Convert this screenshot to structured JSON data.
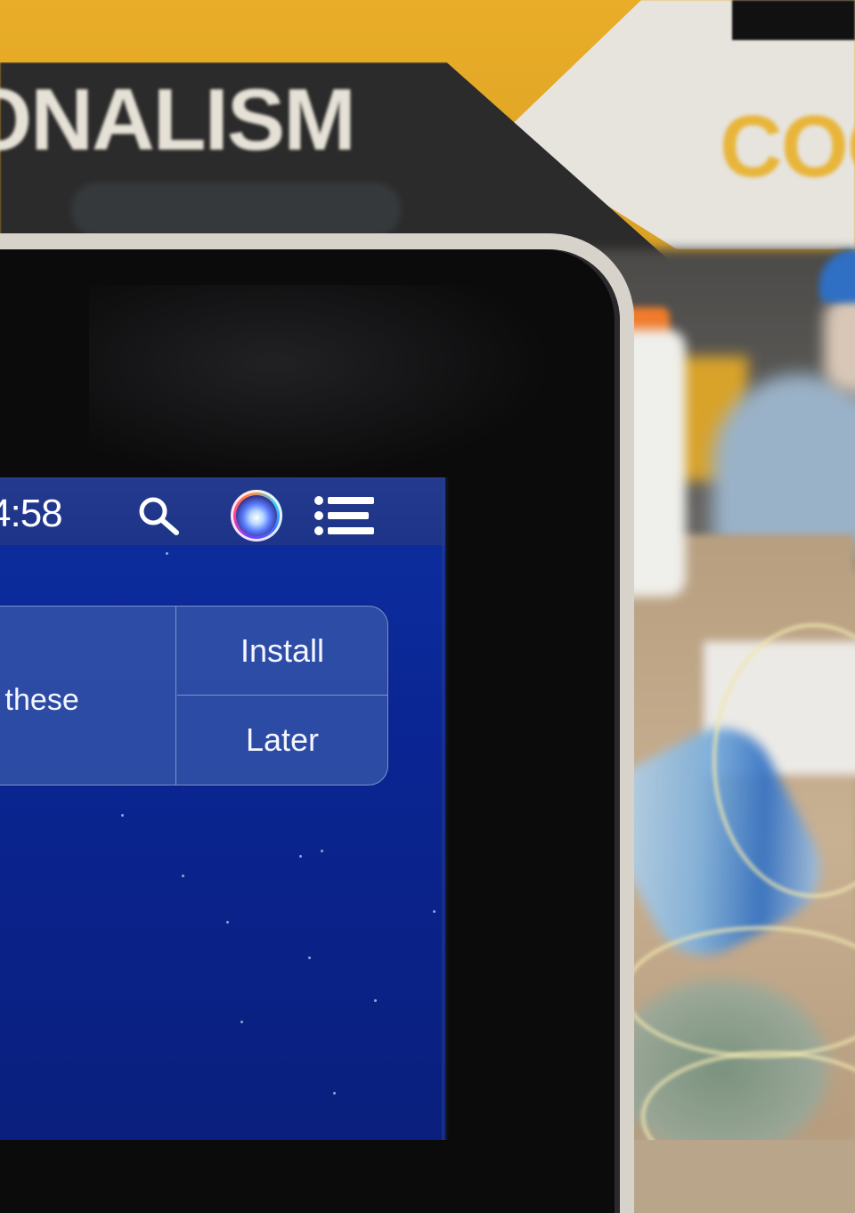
{
  "background": {
    "banner_text_left": "ONALISM",
    "banner_text_right": "COO"
  },
  "menubar": {
    "clock": "4:58",
    "icons": [
      "search-icon",
      "siri-icon",
      "notification-center-icon"
    ]
  },
  "notification": {
    "message_fragment": "ll these",
    "install_label": "Install",
    "later_label": "Later"
  },
  "colors": {
    "desktop_blue": "#0a2593",
    "menubar": "#1d3489",
    "banner_yellow": "#e9ad28",
    "bezel_silver": "#d7d3cb"
  }
}
